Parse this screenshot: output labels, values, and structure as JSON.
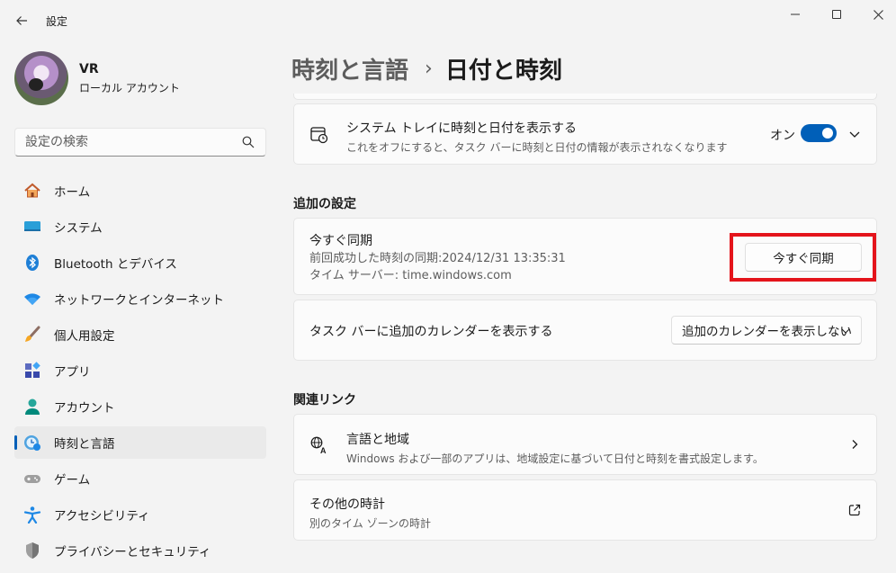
{
  "window": {
    "title": "設定"
  },
  "profile": {
    "name": "VR",
    "account_type": "ローカル アカウント"
  },
  "search": {
    "placeholder": "設定の検索"
  },
  "sidebar": {
    "items": [
      {
        "label": "ホーム",
        "icon": "home-icon"
      },
      {
        "label": "システム",
        "icon": "system-icon"
      },
      {
        "label": "Bluetooth とデバイス",
        "icon": "bluetooth-icon"
      },
      {
        "label": "ネットワークとインターネット",
        "icon": "wifi-icon"
      },
      {
        "label": "個人用設定",
        "icon": "brush-icon"
      },
      {
        "label": "アプリ",
        "icon": "apps-icon"
      },
      {
        "label": "アカウント",
        "icon": "account-icon"
      },
      {
        "label": "時刻と言語",
        "icon": "time-language-icon",
        "active": true
      },
      {
        "label": "ゲーム",
        "icon": "gaming-icon"
      },
      {
        "label": "アクセシビリティ",
        "icon": "accessibility-icon"
      },
      {
        "label": "プライバシーとセキュリティ",
        "icon": "shield-icon"
      }
    ]
  },
  "breadcrumb": {
    "parent": "時刻と言語",
    "separator": "›",
    "current": "日付と時刻"
  },
  "systray_setting": {
    "title": "システム トレイに時刻と日付を表示する",
    "description": "これをオフにすると、タスク バーに時刻と日付の情報が表示されなくなります",
    "toggle_label": "オン",
    "toggle_on": true
  },
  "additional": {
    "section_title": "追加の設定",
    "sync": {
      "title": "今すぐ同期",
      "last_sync": "前回成功した時刻の同期:2024/12/31 13:35:31",
      "time_server": "タイム サーバー: time.windows.com",
      "button_label": "今すぐ同期"
    },
    "calendar": {
      "title": "タスク バーに追加のカレンダーを表示する",
      "selected": "追加のカレンダーを表示しない"
    }
  },
  "related": {
    "section_title": "関連リンク",
    "region": {
      "title": "言語と地域",
      "description": "Windows および一部のアプリは、地域設定に基づいて日付と時刻を書式設定します。"
    },
    "other_clocks": {
      "title": "その他の時計",
      "description": "別のタイム ゾーンの時計"
    }
  },
  "colors": {
    "accent": "#005fb8",
    "highlight": "#e4141b",
    "background": "#f3f3f3",
    "card": "#fbfbfb"
  }
}
